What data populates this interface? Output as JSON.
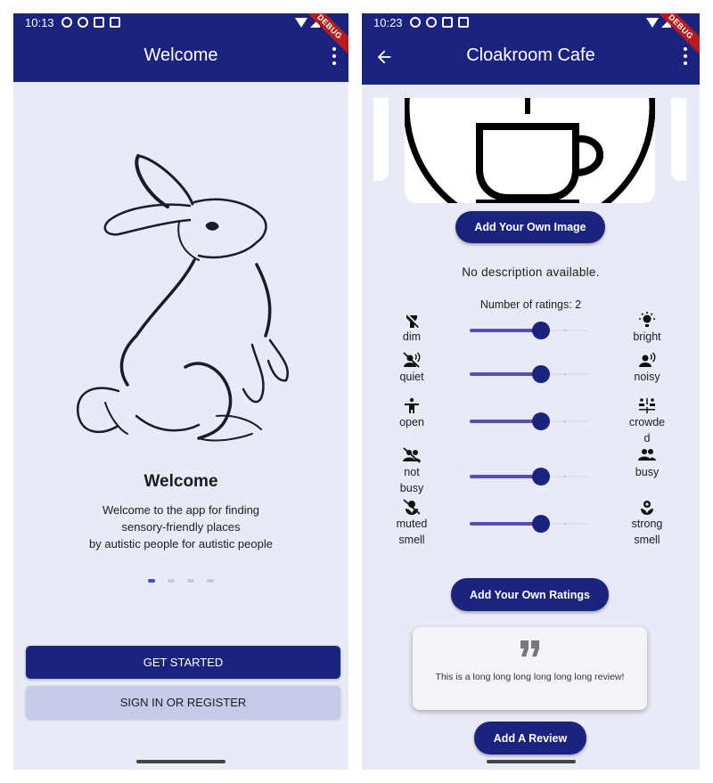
{
  "left_screen": {
    "status": {
      "time": "10:13",
      "debug_label": "DEBUG"
    },
    "appbar": {
      "title": "Welcome",
      "menu_icon": "more-vert-icon"
    },
    "illustration": "rabbit-illustration",
    "onboarding": {
      "heading": "Welcome",
      "line1": "Welcome to the app for finding",
      "line2": "sensory-friendly places",
      "line3": "by autistic people for autistic people",
      "page_count": 4,
      "active_page": 1
    },
    "buttons": {
      "get_started": "GET STARTED",
      "sign_in": "SIGN IN OR REGISTER"
    }
  },
  "right_screen": {
    "status": {
      "time": "10:23",
      "debug_label": "DEBUG"
    },
    "appbar": {
      "title": "Cloakroom Cafe",
      "back_icon": "arrow-back-icon",
      "menu_icon": "more-vert-icon"
    },
    "image_icon": "coffee-cup-icon",
    "add_image_label": "Add Your Own Image",
    "description": "No description available.",
    "num_ratings": "Number of ratings: 2",
    "ratings": [
      {
        "left": "dim",
        "right": "bright",
        "left_icon": "flashlight-off-icon",
        "right_icon": "light-bulb-icon",
        "value": 0.6
      },
      {
        "left": "quiet",
        "right": "noisy",
        "left_icon": "voice-off-icon",
        "right_icon": "record-voice-icon",
        "value": 0.6
      },
      {
        "left": "open",
        "right": "crowde d",
        "left_icon": "person-arms-open-icon",
        "right_icon": "people-crowded-icon",
        "value": 0.6
      },
      {
        "left": "not busy",
        "right": "busy",
        "left_icon": "people-off-icon",
        "right_icon": "people-icon",
        "value": 0.6
      },
      {
        "left": "muted smell",
        "right": "strong smell",
        "left_icon": "flower-off-icon",
        "right_icon": "flower-icon",
        "value": 0.6
      }
    ],
    "add_ratings_label": "Add Your Own Ratings",
    "review": {
      "quote_icon": "format-quote-icon",
      "text": "This is a long long long long long long review!"
    },
    "add_review_label": "Add A Review",
    "colors": {
      "primary": "#1a237e",
      "background": "#e8eaf6",
      "slider_active": "#5c4db1",
      "debug": "#b71c1c"
    }
  }
}
